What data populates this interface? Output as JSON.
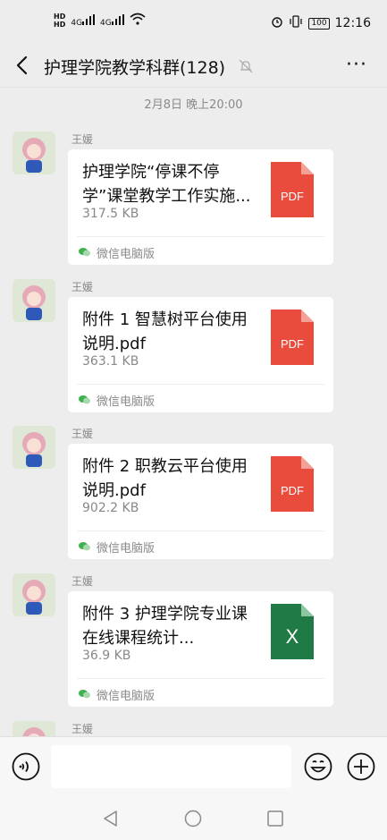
{
  "status_bar": {
    "hd1": "HD",
    "hd2": "HD",
    "net1": "4G",
    "net2": "4G",
    "battery": "100",
    "time": "12:16"
  },
  "header": {
    "title": "护理学院教学科群(128)"
  },
  "timestamp": "2月8日 晚上20:00",
  "messages": [
    {
      "sender": "王媛",
      "file_name": "护理学院“停课不停学”课堂教学工作实施...",
      "file_size": "317.5 KB",
      "file_type": "PDF",
      "icon_color": "#e94b3c",
      "source": "微信电脑版"
    },
    {
      "sender": "王媛",
      "file_name": "附件 1 智慧树平台使用说明.pdf",
      "file_size": "363.1 KB",
      "file_type": "PDF",
      "icon_color": "#e94b3c",
      "source": "微信电脑版"
    },
    {
      "sender": "王媛",
      "file_name": "附件 2 职教云平台使用说明.pdf",
      "file_size": "902.2 KB",
      "file_type": "PDF",
      "icon_color": "#e94b3c",
      "source": "微信电脑版"
    },
    {
      "sender": "王媛",
      "file_name": "附件 3 护理学院专业课在线课程统计...",
      "file_size": "36.9 KB",
      "file_type": "X",
      "icon_color": "#1f7a45",
      "source": "微信电脑版"
    },
    {
      "sender": "王媛"
    }
  ],
  "icons": {
    "back": "chevron-left-icon",
    "mute": "bell-off-icon",
    "more": "more-dots-icon",
    "voice": "voice-icon",
    "emoji": "emoji-icon",
    "plus": "plus-icon"
  },
  "more_glyph": "···"
}
